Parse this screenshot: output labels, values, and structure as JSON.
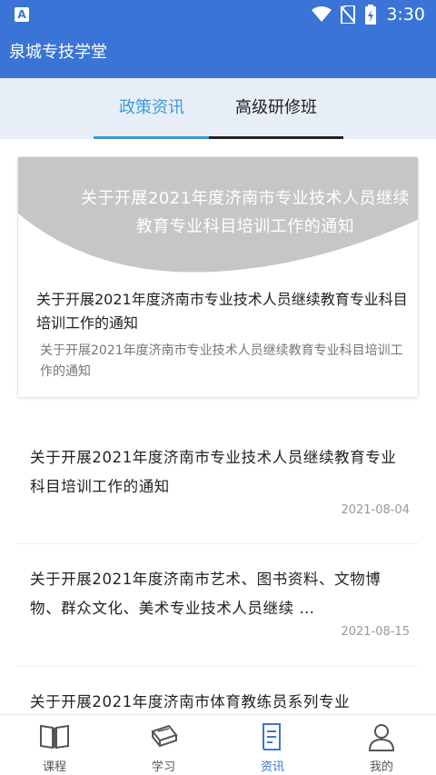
{
  "status_bar": {
    "time": "3:30",
    "app_badge": "A"
  },
  "app_bar": {
    "title": "泉城专技学堂"
  },
  "tabs": [
    {
      "label": "政策资讯"
    },
    {
      "label": "高级研修班"
    }
  ],
  "featured": {
    "banner_text": "关于开展2021年度济南市专业技术人员继续教育专业科目培训工作的通知",
    "title": "关于开展2021年度济南市专业技术人员继续教育专业科目培训工作的通知",
    "description": "关于开展2021年度济南市专业技术人员继续教育专业科目培训工作的通知"
  },
  "news": [
    {
      "title": "关于开展2021年度济南市专业技术人员继续教育专业科目培训工作的通知",
      "date": "2021-08-04"
    },
    {
      "title": "关于开展2021年度济南市艺术、图书资料、文物博物、群众文化、美术专业技术人员继续 …",
      "date": "2021-08-15"
    },
    {
      "title": "关于开展2021年度济南市体育教练员系列专业"
    }
  ],
  "bottom_nav": [
    {
      "label": "课程",
      "icon": "book-open-icon"
    },
    {
      "label": "学习",
      "icon": "books-stack-icon"
    },
    {
      "label": "资讯",
      "icon": "document-icon"
    },
    {
      "label": "我的",
      "icon": "user-icon"
    }
  ],
  "colors": {
    "primary": "#3a74d6",
    "tab_active": "#3a9ad8",
    "tab_bg": "#e8eef7"
  }
}
